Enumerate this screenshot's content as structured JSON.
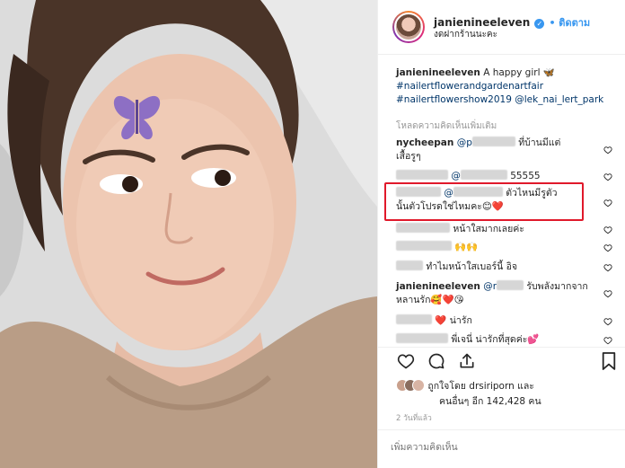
{
  "post": {
    "username": "janienineeleven",
    "verified_icon": "verified-badge-icon",
    "follow_label": "• ติดตาม",
    "location": "งดฝากร้านนะคะ",
    "caption_text": "A happy girl",
    "caption_emoji": "🦋",
    "hashtag1": "#nailertflowerandgardenartfair",
    "hashtag2": "#nailertflowershow2019",
    "mention": "@lek_nai_lert_park",
    "load_more": "โหลดความคิดเห็นเพิ่มเติม"
  },
  "comments": [
    {
      "user": "nycheepan",
      "mention": "@p",
      "text": "ที่บ้านมีแต่",
      "text2": "เสื้อรูๆ"
    },
    {
      "user": "",
      "mention": "@",
      "text": "55555",
      "text2": ""
    },
    {
      "user": "",
      "mention": "@",
      "text": "ตัวไหนมีรูตัว",
      "text2": "นั้นตัวโปรดใช่ไหมคะ😊❤️"
    },
    {
      "user": "",
      "mention": "",
      "text": "หน้าใสมากเลยค่ะ",
      "text2": ""
    },
    {
      "user": "",
      "mention": "",
      "text": "🙌🙌",
      "text2": ""
    },
    {
      "user": "",
      "mention": "",
      "text": "ทำไมหน้าใสเบอร์นี้ อิจ",
      "text2": ""
    },
    {
      "user": "janienineeleven",
      "mention": "@r",
      "text": "รับพลังมากจาก",
      "text2": "หลานรัก🥰❤️😘"
    },
    {
      "user": "",
      "mention": "",
      "text": "❤️ น่ารัก",
      "text2": ""
    },
    {
      "user": "",
      "mention": "",
      "text": "พี่เจนี่ น่ารักที่สุดค่ะ💕",
      "text2": ""
    }
  ],
  "likes": {
    "line1": "ถูกใจโดย drsiriporn และ",
    "line2": "คนอื่นๆ อีก 142,428 คน"
  },
  "timestamp": "2 วันที่แล้ว",
  "add_comment_placeholder": "เพิ่มความคิดเห็น",
  "colors": {
    "link": "#003569",
    "follow": "#3897f0",
    "highlight": "#e0192b"
  }
}
